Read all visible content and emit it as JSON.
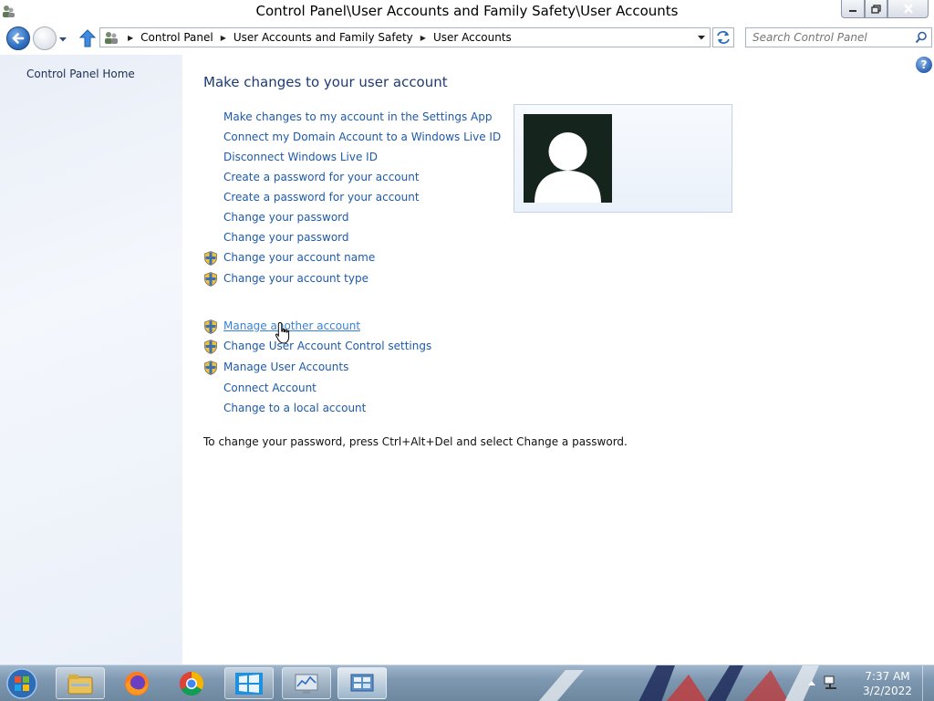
{
  "window": {
    "title": "Control Panel\\User Accounts and Family Safety\\User Accounts"
  },
  "navbar": {
    "breadcrumb": [
      "Control Panel",
      "User Accounts and Family Safety",
      "User Accounts"
    ],
    "search_placeholder": "Search Control Panel"
  },
  "sidebar": {
    "home_label": "Control Panel Home"
  },
  "main": {
    "title": "Make changes to your user account",
    "links_group1": [
      {
        "label": "Make changes to my account in the Settings App",
        "shield": false
      },
      {
        "label": "Connect my Domain Account to a Windows Live ID",
        "shield": false
      },
      {
        "label": "Disconnect Windows Live ID",
        "shield": false
      },
      {
        "label": "Create a password for your account",
        "shield": false
      },
      {
        "label": "Create a password for your account",
        "shield": false
      },
      {
        "label": "Change your password",
        "shield": false
      },
      {
        "label": "Change your password",
        "shield": false
      },
      {
        "label": "Change your account name",
        "shield": true
      },
      {
        "label": "Change your account type",
        "shield": true
      }
    ],
    "links_group2": [
      {
        "label": "Manage another account",
        "shield": true,
        "hovered": true
      },
      {
        "label": "Change User Account Control settings",
        "shield": true
      },
      {
        "label": "Manage User Accounts",
        "shield": true
      },
      {
        "label": "Connect Account",
        "shield": false
      },
      {
        "label": "Change to a local account",
        "shield": false
      }
    ],
    "note": "To change your password, press Ctrl+Alt+Del and select Change a password.",
    "help_glyph": "?"
  },
  "taskbar": {
    "items": [
      "start-orb-icon",
      "file-explorer-icon",
      "firefox-icon",
      "chrome-icon",
      "windows-store-icon",
      "performance-monitor-icon",
      "control-panel-icon"
    ],
    "time": "7:37 AM",
    "date": "3/2/2022"
  },
  "colors": {
    "link": "#1e5aa8",
    "title": "#1e3a75",
    "sidebar_bg": "#eef2f9",
    "taskbar": "#7e98b1"
  }
}
